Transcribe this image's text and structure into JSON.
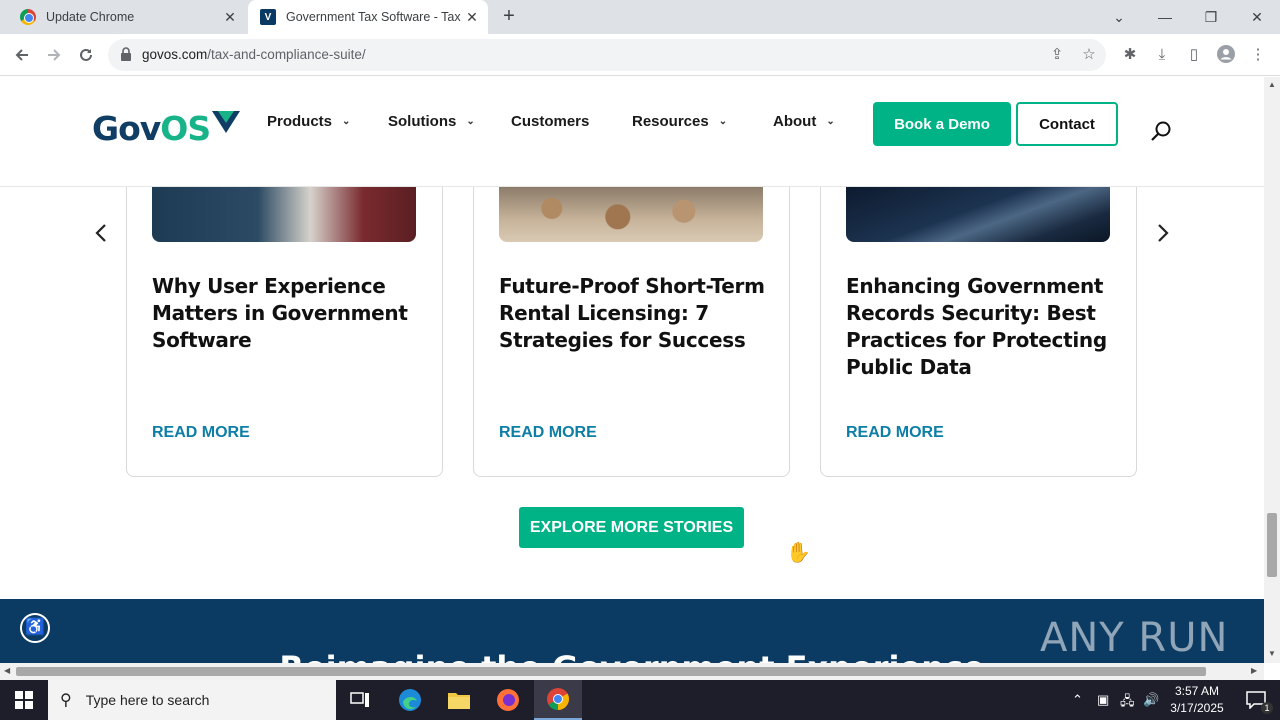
{
  "browser": {
    "tabs": [
      {
        "title": "Update Chrome",
        "close": "✕"
      },
      {
        "title": "Government Tax Software - Tax &",
        "close": "✕"
      }
    ],
    "new_tab": "+",
    "window_controls": {
      "dropdown": "⌄",
      "minimize": "—",
      "restore": "❐",
      "close": "✕"
    },
    "url_domain": "govos.com",
    "url_path": "/tax-and-compliance-suite/"
  },
  "site": {
    "logo_text_a": "Gov",
    "logo_text_b": "OS",
    "nav": [
      {
        "label": "Products",
        "chevron": "⌄"
      },
      {
        "label": "Solutions",
        "chevron": "⌄"
      },
      {
        "label": "Customers"
      },
      {
        "label": "Resources",
        "chevron": "⌄"
      },
      {
        "label": "About",
        "chevron": "⌄"
      }
    ],
    "book_demo": "Book a Demo",
    "contact": "Contact"
  },
  "cards": [
    {
      "title": "Why User Experience Matters in Government Software",
      "cta": "READ MORE"
    },
    {
      "title": "Future-Proof Short-Term Rental Licensing: 7 Strategies for Success",
      "cta": "READ MORE"
    },
    {
      "title": "Enhancing Government Records Security: Best Practices for Protecting Public Data",
      "cta": "READ MORE"
    }
  ],
  "carousel": {
    "prev": "‹",
    "next": "›"
  },
  "explore_button": "EXPLORE MORE STORIES",
  "band_heading": "Reimagine the Government Experience",
  "watermark": "ANY RUN",
  "taskbar": {
    "search_placeholder": "Type here to search",
    "time": "3:57 AM",
    "date": "3/17/2025",
    "notification_count": "1"
  },
  "colors": {
    "brand_green": "#00b386",
    "brand_navy": "#0b3b63",
    "link_teal": "#0d7ea6"
  }
}
